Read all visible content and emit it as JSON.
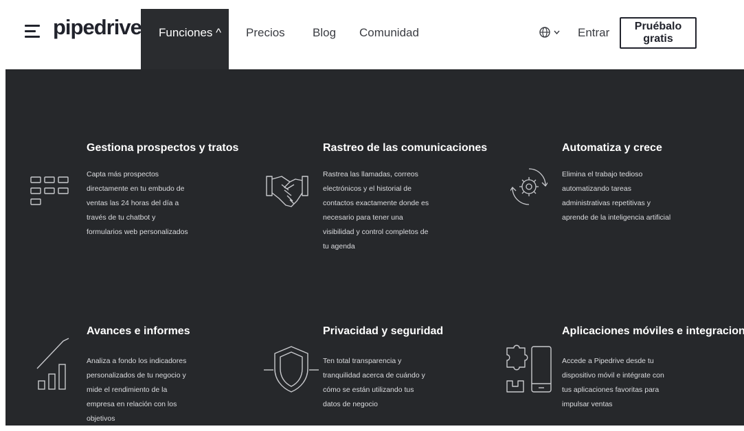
{
  "header": {
    "logo": "pipedrive",
    "nav": {
      "features_label": "Funciones ^",
      "pricing_label": "Precios",
      "blog_label": "Blog",
      "community_label": "Comunidad"
    },
    "language_label": "⊕ ∨",
    "login_label": "Entrar",
    "cta_label": "Pruébalo gratis"
  },
  "menu": {
    "features": [
      {
        "icon": "kanban-grid-icon",
        "title": "Gestiona prospectos y tratos",
        "description": "Capta más prospectos directamente en tu embudo de ventas las 24 horas del día a través de tu chatbot y formularios web personalizados"
      },
      {
        "icon": "handshake-icon",
        "title": "Rastreo de las comunicaciones",
        "description": "Rastrea las llamadas, correos electrónicos y el historial de contactos exactamente donde es necesario para tener una visibilidad y control completos de tu agenda"
      },
      {
        "icon": "gear-cycle-icon",
        "title": "Automatiza y crece",
        "description": "Elimina el trabajo tedioso automatizando tareas administrativas repetitivas y aprende de la inteligencia artificial"
      },
      {
        "icon": "growth-chart-icon",
        "title": "Avances e informes",
        "description": "Analiza a fondo los indicadores personalizados de tu negocio y mide el rendimiento de la empresa en relación con los objetivos"
      },
      {
        "icon": "shield-icon",
        "title": "Privacidad y seguridad",
        "description": "Ten total transparencia y tranquilidad acerca de cuándo y cómo se están utilizando tus datos de negocio"
      },
      {
        "icon": "mobile-puzzle-icon",
        "title": "Aplicaciones móviles e integraciones",
        "description": "Accede a Pipedrive desde tu dispositivo móvil e intégrate con tus aplicaciones favoritas para impulsar ventas"
      }
    ]
  },
  "colors": {
    "menu_bg": "#26282b",
    "active_tab_bg": "#2a2c2f",
    "text_dark": "#21232c",
    "text_light": "#ffffff"
  }
}
